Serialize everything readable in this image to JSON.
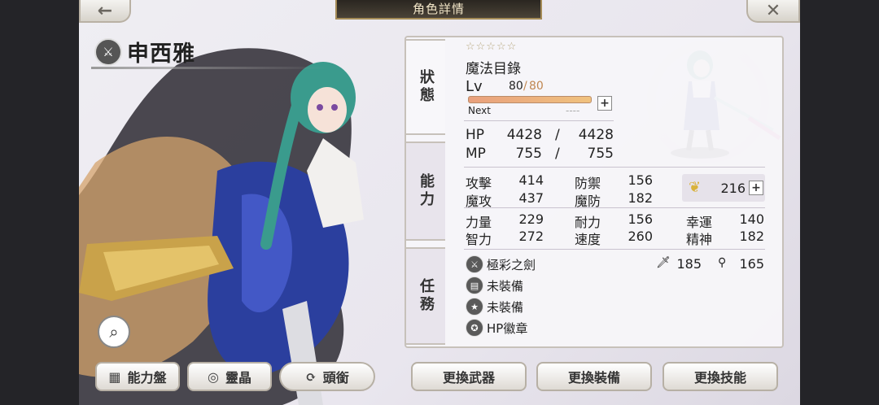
{
  "header": {
    "title": "角色詳情",
    "back_icon": "←",
    "close_icon": "✕"
  },
  "character": {
    "name": "申西雅"
  },
  "tabs": [
    {
      "label": "狀態",
      "active": true
    },
    {
      "label": "能力",
      "active": false
    },
    {
      "label": "任務",
      "active": false
    }
  ],
  "status": {
    "stars": "☆☆☆☆☆",
    "job": "魔法目錄",
    "lv_label": "Lv",
    "lv_current": "80",
    "lv_sep": "/",
    "lv_max": "80",
    "next_label": "Next",
    "next_value": "----",
    "exp_progress": 1.0,
    "hp_label": "HP",
    "hp_cur": "4428",
    "hp_sep": "/",
    "hp_max": "4428",
    "mp_label": "MP",
    "mp_cur": "755",
    "mp_sep": "/",
    "mp_max": "755"
  },
  "stats": {
    "atk_label": "攻擊",
    "atk": "414",
    "def_label": "防禦",
    "def": "156",
    "matk_label": "魔攻",
    "matk": "437",
    "mdef_label": "魔防",
    "mdef": "182",
    "str_label": "力量",
    "str": "229",
    "vit_label": "耐力",
    "vit": "156",
    "luck_label": "幸運",
    "luck": "140",
    "int_label": "智力",
    "int": "272",
    "spd_label": "速度",
    "spd": "260",
    "spi_label": "精神",
    "spi": "182",
    "wing_value": "216"
  },
  "equipment": [
    {
      "label": "極彩之劍",
      "icon": "sword-icon"
    },
    {
      "label": "未裝備",
      "icon": "armor-icon"
    },
    {
      "label": "未裝備",
      "icon": "star-icon"
    },
    {
      "label": "HP徽章",
      "icon": "badge-icon"
    }
  ],
  "weapon_stats": {
    "phys": "185",
    "mag": "165"
  },
  "buttons": {
    "ability_board": "能力盤",
    "spirit": "靈晶",
    "rank": "頭銜",
    "change_weapon": "更換武器",
    "change_gear": "更換裝備",
    "change_skill": "更換技能"
  }
}
